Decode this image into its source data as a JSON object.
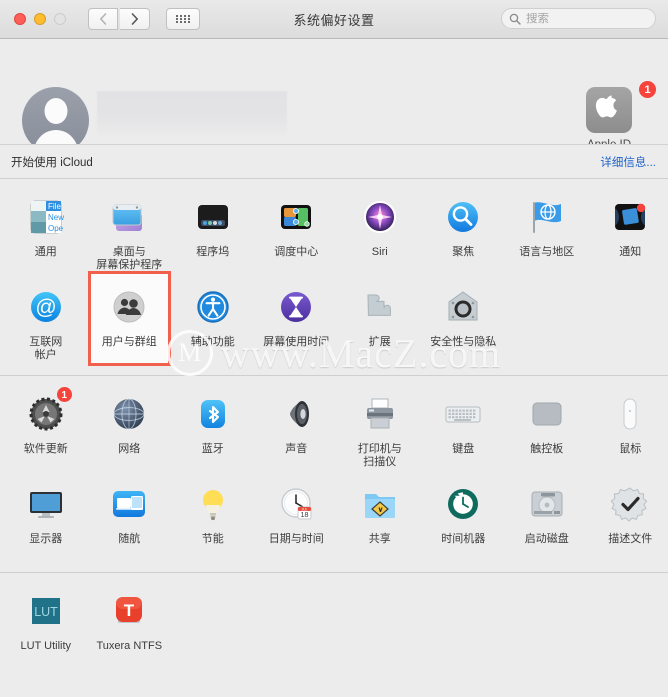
{
  "window": {
    "title": "系统偏好设置",
    "traffic_lights": [
      "close",
      "minimize",
      "maximize"
    ]
  },
  "toolbar": {
    "back_label": "‹",
    "forward_label": "›",
    "show_all_label": "显示全部",
    "search_placeholder": "搜索",
    "search_value": ""
  },
  "account": {
    "name_redacted": "",
    "apple_id_label": "Apple ID",
    "apple_id_badge": "1"
  },
  "icloud": {
    "message": "开始使用 iCloud",
    "details_link": "详细信息..."
  },
  "watermark": {
    "logo": "M",
    "text": "www.MacZ.com"
  },
  "colors": {
    "accent_link": "#2163c9",
    "badge_red": "#f4443b",
    "highlight_box": "#f0604d",
    "window_bg": "#ececec"
  },
  "panes": {
    "row1": [
      {
        "name": "general",
        "label": "通用",
        "icon": "general-icon"
      },
      {
        "name": "desktop-screensaver",
        "label": "桌面与\n屏幕保护程序",
        "icon": "desktop-icon"
      },
      {
        "name": "dock",
        "label": "程序坞",
        "icon": "dock-icon"
      },
      {
        "name": "mission-control",
        "label": "调度中心",
        "icon": "mission-control-icon"
      },
      {
        "name": "siri",
        "label": "Siri",
        "icon": "siri-icon"
      },
      {
        "name": "spotlight",
        "label": "聚焦",
        "icon": "spotlight-icon"
      },
      {
        "name": "language-region",
        "label": "语言与地区",
        "icon": "language-region-icon"
      },
      {
        "name": "notifications",
        "label": "通知",
        "icon": "notifications-icon"
      }
    ],
    "row2": [
      {
        "name": "internet-accounts",
        "label": "互联网\n帐户",
        "icon": "internet-accounts-icon"
      },
      {
        "name": "users-groups",
        "label": "用户与群组",
        "icon": "users-groups-icon",
        "selected": true
      },
      {
        "name": "accessibility",
        "label": "辅助功能",
        "icon": "accessibility-icon"
      },
      {
        "name": "screen-time",
        "label": "屏幕使用时间",
        "icon": "screen-time-icon"
      },
      {
        "name": "extensions",
        "label": "扩展",
        "icon": "extensions-icon"
      },
      {
        "name": "security-privacy",
        "label": "安全性与隐私",
        "icon": "security-privacy-icon"
      }
    ],
    "row3": [
      {
        "name": "software-update",
        "label": "软件更新",
        "icon": "software-update-icon",
        "badge": "1"
      },
      {
        "name": "network",
        "label": "网络",
        "icon": "network-icon"
      },
      {
        "name": "bluetooth",
        "label": "蓝牙",
        "icon": "bluetooth-icon"
      },
      {
        "name": "sound",
        "label": "声音",
        "icon": "sound-icon"
      },
      {
        "name": "printers-scanners",
        "label": "打印机与\n扫描仪",
        "icon": "printer-icon"
      },
      {
        "name": "keyboard",
        "label": "键盘",
        "icon": "keyboard-icon"
      },
      {
        "name": "trackpad",
        "label": "触控板",
        "icon": "trackpad-icon"
      },
      {
        "name": "mouse",
        "label": "鼠标",
        "icon": "mouse-icon"
      }
    ],
    "row4": [
      {
        "name": "displays",
        "label": "显示器",
        "icon": "display-icon"
      },
      {
        "name": "sidecar",
        "label": "随航",
        "icon": "sidecar-icon"
      },
      {
        "name": "energy-saver",
        "label": "节能",
        "icon": "lightbulb-icon"
      },
      {
        "name": "date-time",
        "label": "日期与时间",
        "icon": "clock-calendar-icon",
        "calendar_month": "JUL",
        "calendar_day": "18"
      },
      {
        "name": "sharing",
        "label": "共享",
        "icon": "sharing-folder-icon"
      },
      {
        "name": "time-machine",
        "label": "时间机器",
        "icon": "time-machine-icon"
      },
      {
        "name": "startup-disk",
        "label": "启动磁盘",
        "icon": "hard-disk-icon"
      },
      {
        "name": "profiles",
        "label": "描述文件",
        "icon": "profiles-badge-icon"
      }
    ],
    "row5": [
      {
        "name": "lut-utility",
        "label": "LUT Utility",
        "icon": "lut-utility-icon",
        "icon_text": "LUT"
      },
      {
        "name": "tuxera-ntfs",
        "label": "Tuxera NTFS",
        "icon": "tuxera-ntfs-icon",
        "icon_text": "T"
      }
    ]
  }
}
